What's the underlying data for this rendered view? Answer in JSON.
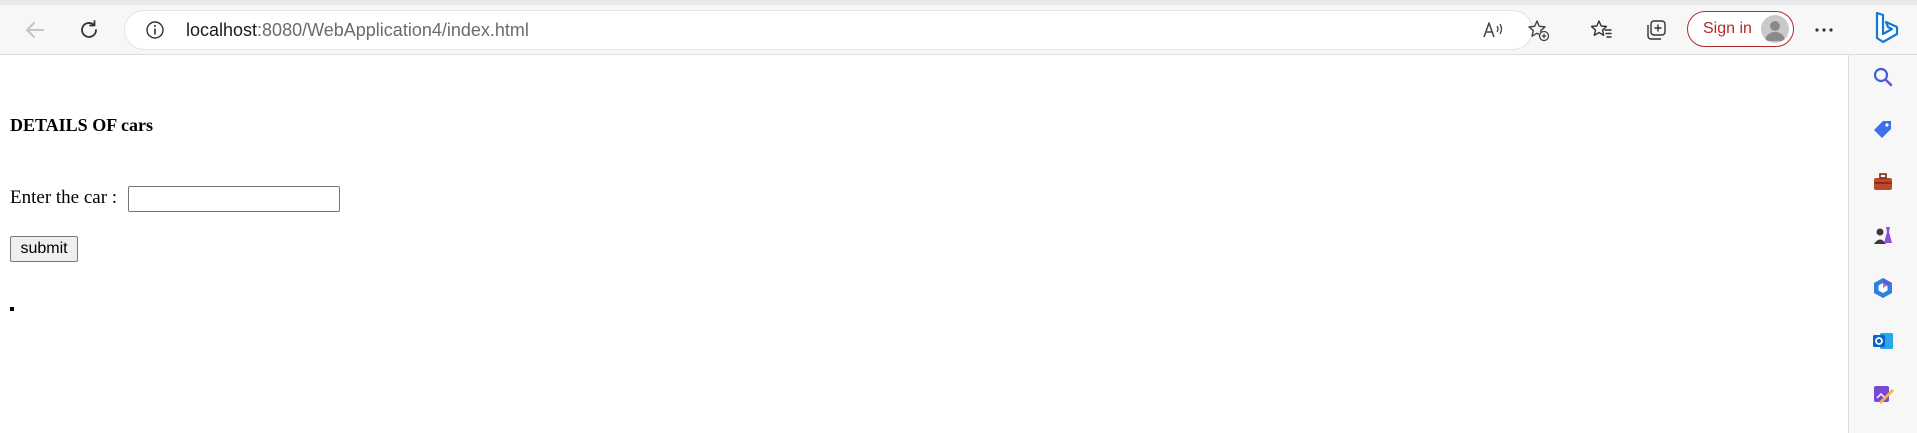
{
  "browser": {
    "url_host": "localhost",
    "url_path": ":8080/WebApplication4/index.html",
    "signin_label": "Sign in",
    "icons": {
      "back": "back-arrow-icon",
      "refresh": "refresh-icon",
      "info": "info-icon",
      "read_aloud": "read-aloud-icon",
      "add_favorite": "add-favorite-icon",
      "favorites": "favorites-icon",
      "collections": "collections-icon",
      "more": "more-icon",
      "bing": "bing-copilot-icon"
    }
  },
  "sidebar": {
    "items": [
      {
        "name": "search-icon",
        "color": "#3b63d6"
      },
      {
        "name": "shopping-tag-icon",
        "color": "#3e6ee8"
      },
      {
        "name": "tools-icon",
        "color": "#c0472a"
      },
      {
        "name": "games-icon",
        "color": "#8c4fe0"
      },
      {
        "name": "microsoft-365-icon",
        "color": "#2d7fe0"
      },
      {
        "name": "outlook-icon",
        "color": "#0a63c9"
      },
      {
        "name": "designer-icon",
        "color": "#7a48d8"
      }
    ]
  },
  "page": {
    "title": "DETAILS OF cars",
    "car_label": "Enter the car :",
    "car_input_value": "",
    "submit_label": "submit"
  },
  "colors": {
    "signin_accent": "#b22a2a",
    "toolbar_bg": "#f7f7f7"
  }
}
